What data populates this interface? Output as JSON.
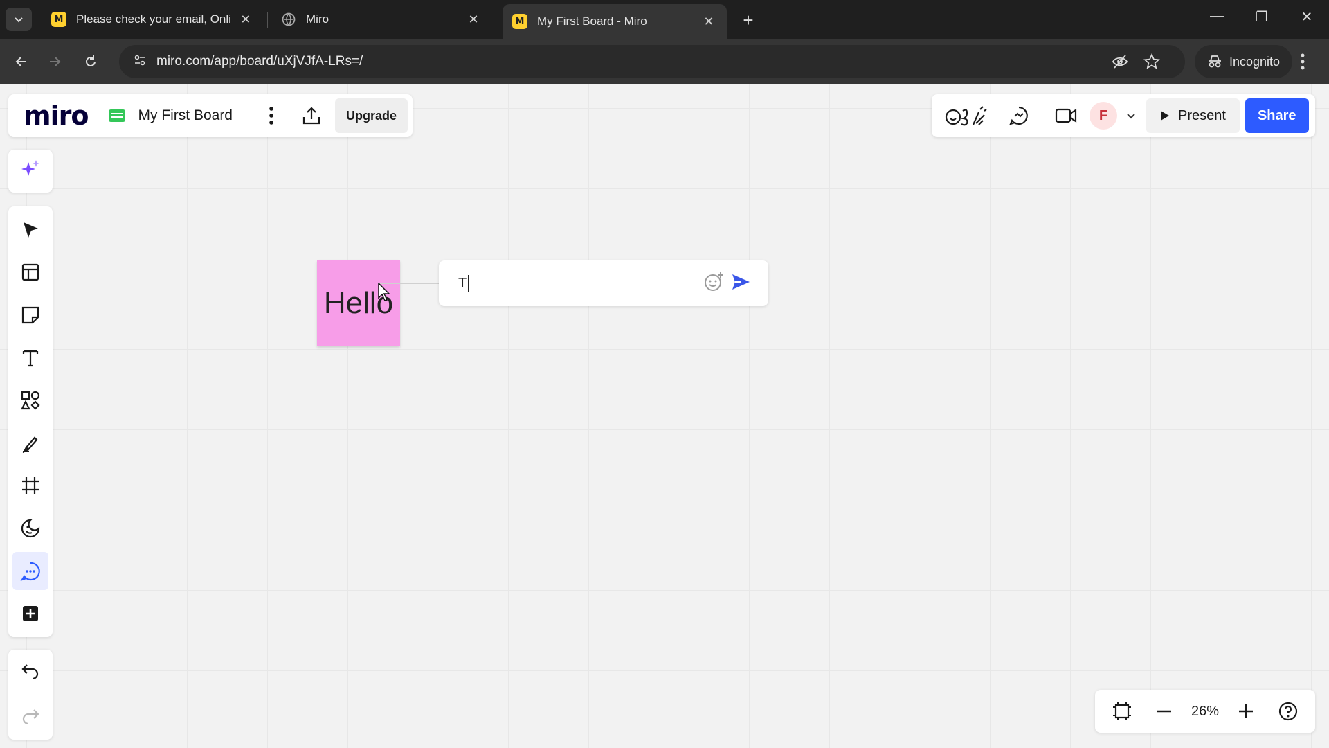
{
  "browser": {
    "tabs": [
      {
        "title": "Please check your email, Online",
        "favicon": "miro-icon",
        "active": false
      },
      {
        "title": "Miro",
        "favicon": "globe-icon",
        "active": false
      },
      {
        "title": "My First Board - Miro",
        "favicon": "miro-icon",
        "active": true
      }
    ],
    "url": "miro.com/app/board/uXjVJfA-LRs=/",
    "incognito_label": "Incognito",
    "favicon_letter": "M"
  },
  "header": {
    "logo": "miro",
    "board_name": "My First Board",
    "upgrade_label": "Upgrade",
    "avatar_initial": "F",
    "present_label": "Present",
    "share_label": "Share"
  },
  "toolbar": {
    "tools": [
      "select-icon",
      "templates-icon",
      "sticky-note-icon",
      "text-icon",
      "shapes-icon",
      "pen-icon",
      "frame-icon",
      "stickers-icon",
      "comment-icon",
      "more-apps-icon"
    ],
    "active_tool": "comment-icon"
  },
  "board": {
    "sticky_text": "Hello",
    "sticky_color": "#f79de8",
    "comment_value": "T"
  },
  "zoom": {
    "level": "26%"
  },
  "colors": {
    "accent": "#2d5bff",
    "ai_purple": "#7b4dff"
  }
}
